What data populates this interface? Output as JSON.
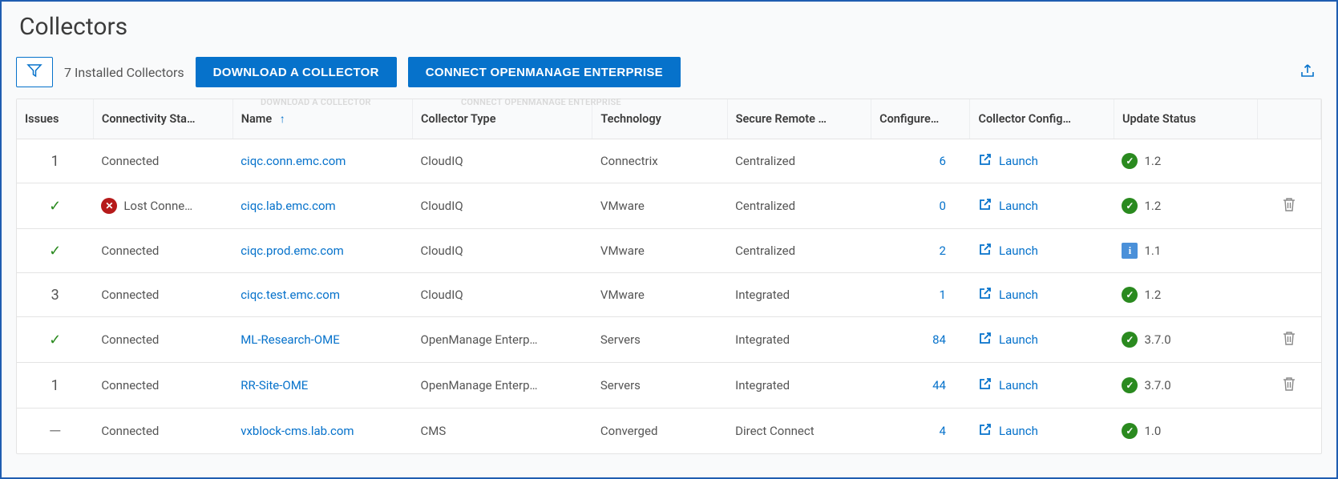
{
  "page": {
    "title": "Collectors",
    "installed_label": "7 Installed Collectors",
    "download_label": "DOWNLOAD A COLLECTOR",
    "connect_label": "CONNECT OPENMANAGE ENTERPRISE"
  },
  "ghost": {
    "download": "DOWNLOAD A COLLECTOR",
    "connect": "CONNECT OPENMANAGE ENTERPRISE"
  },
  "columns": {
    "issues": "Issues",
    "connectivity": "Connectivity Sta…",
    "name": "Name",
    "collector_type": "Collector Type",
    "technology": "Technology",
    "secure_remote": "Secure Remote …",
    "configured": "Configure…",
    "collector_config": "Collector Config…",
    "update_status": "Update Status"
  },
  "launch_label": "Launch",
  "rows": [
    {
      "issues_kind": "count",
      "issues": "1",
      "conn_kind": "plain",
      "conn_label": "Connected",
      "name": "ciqc.conn.emc.com",
      "type": "CloudIQ",
      "tech": "Connectrix",
      "secure": "Centralized",
      "configured": "6",
      "update_kind": "ok",
      "update_label": "1.2",
      "deletable": false
    },
    {
      "issues_kind": "check",
      "issues": "",
      "conn_kind": "error",
      "conn_label": "Lost Conne…",
      "name": "ciqc.lab.emc.com",
      "type": "CloudIQ",
      "tech": "VMware",
      "secure": "Centralized",
      "configured": "0",
      "update_kind": "ok",
      "update_label": "1.2",
      "deletable": true
    },
    {
      "issues_kind": "check",
      "issues": "",
      "conn_kind": "plain",
      "conn_label": "Connected",
      "name": "ciqc.prod.emc.com",
      "type": "CloudIQ",
      "tech": "VMware",
      "secure": "Centralized",
      "configured": "2",
      "update_kind": "info",
      "update_label": "1.1",
      "deletable": false
    },
    {
      "issues_kind": "count",
      "issues": "3",
      "conn_kind": "plain",
      "conn_label": "Connected",
      "name": "ciqc.test.emc.com",
      "type": "CloudIQ",
      "tech": "VMware",
      "secure": "Integrated",
      "configured": "1",
      "update_kind": "ok",
      "update_label": "1.2",
      "deletable": false
    },
    {
      "issues_kind": "check",
      "issues": "",
      "conn_kind": "plain",
      "conn_label": "Connected",
      "name": "ML-Research-OME",
      "type": "OpenManage Enterp…",
      "tech": "Servers",
      "secure": "Integrated",
      "configured": "84",
      "update_kind": "ok",
      "update_label": "3.7.0",
      "deletable": true
    },
    {
      "issues_kind": "count",
      "issues": "1",
      "conn_kind": "plain",
      "conn_label": "Connected",
      "name": "RR-Site-OME",
      "type": "OpenManage Enterp…",
      "tech": "Servers",
      "secure": "Integrated",
      "configured": "44",
      "update_kind": "ok",
      "update_label": "3.7.0",
      "deletable": true
    },
    {
      "issues_kind": "dash",
      "issues": "",
      "conn_kind": "plain",
      "conn_label": "Connected",
      "name": "vxblock-cms.lab.com",
      "type": "CMS",
      "tech": "Converged",
      "secure": "Direct Connect",
      "configured": "4",
      "update_kind": "ok",
      "update_label": "1.0",
      "deletable": false
    }
  ]
}
